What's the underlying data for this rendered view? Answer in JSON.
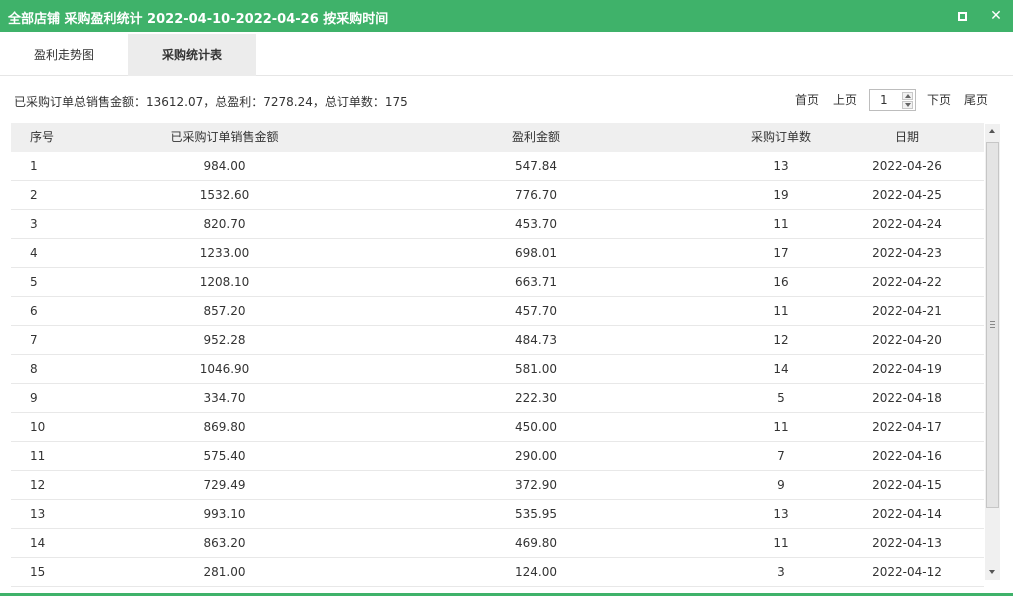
{
  "window": {
    "title": "全部店铺 采购盈利统计 2022-04-10-2022-04-26 按采购时间",
    "accent_color": "#3fb26a",
    "maximize_icon": "maximize-icon",
    "close_icon": "close-icon",
    "close_glyph": "✕"
  },
  "tabs": [
    {
      "label": "盈利走势图",
      "active": false
    },
    {
      "label": "采购统计表",
      "active": true
    }
  ],
  "summary": {
    "text": "已采购订单总销售金额：13612.07，总盈利：7278.24，总订单数：175"
  },
  "pager": {
    "first": "首页",
    "prev": "上页",
    "page": "1",
    "next": "下页",
    "last": "尾页"
  },
  "table": {
    "columns": [
      "序号",
      "已采购订单销售金额",
      "盈利金额",
      "采购订单数",
      "日期"
    ],
    "rows": [
      [
        "1",
        "984.00",
        "547.84",
        "13",
        "2022-04-26"
      ],
      [
        "2",
        "1532.60",
        "776.70",
        "19",
        "2022-04-25"
      ],
      [
        "3",
        "820.70",
        "453.70",
        "11",
        "2022-04-24"
      ],
      [
        "4",
        "1233.00",
        "698.01",
        "17",
        "2022-04-23"
      ],
      [
        "5",
        "1208.10",
        "663.71",
        "16",
        "2022-04-22"
      ],
      [
        "6",
        "857.20",
        "457.70",
        "11",
        "2022-04-21"
      ],
      [
        "7",
        "952.28",
        "484.73",
        "12",
        "2022-04-20"
      ],
      [
        "8",
        "1046.90",
        "581.00",
        "14",
        "2022-04-19"
      ],
      [
        "9",
        "334.70",
        "222.30",
        "5",
        "2022-04-18"
      ],
      [
        "10",
        "869.80",
        "450.00",
        "11",
        "2022-04-17"
      ],
      [
        "11",
        "575.40",
        "290.00",
        "7",
        "2022-04-16"
      ],
      [
        "12",
        "729.49",
        "372.90",
        "9",
        "2022-04-15"
      ],
      [
        "13",
        "993.10",
        "535.95",
        "13",
        "2022-04-14"
      ],
      [
        "14",
        "863.20",
        "469.80",
        "11",
        "2022-04-13"
      ],
      [
        "15",
        "281.00",
        "124.00",
        "3",
        "2022-04-12"
      ]
    ]
  }
}
